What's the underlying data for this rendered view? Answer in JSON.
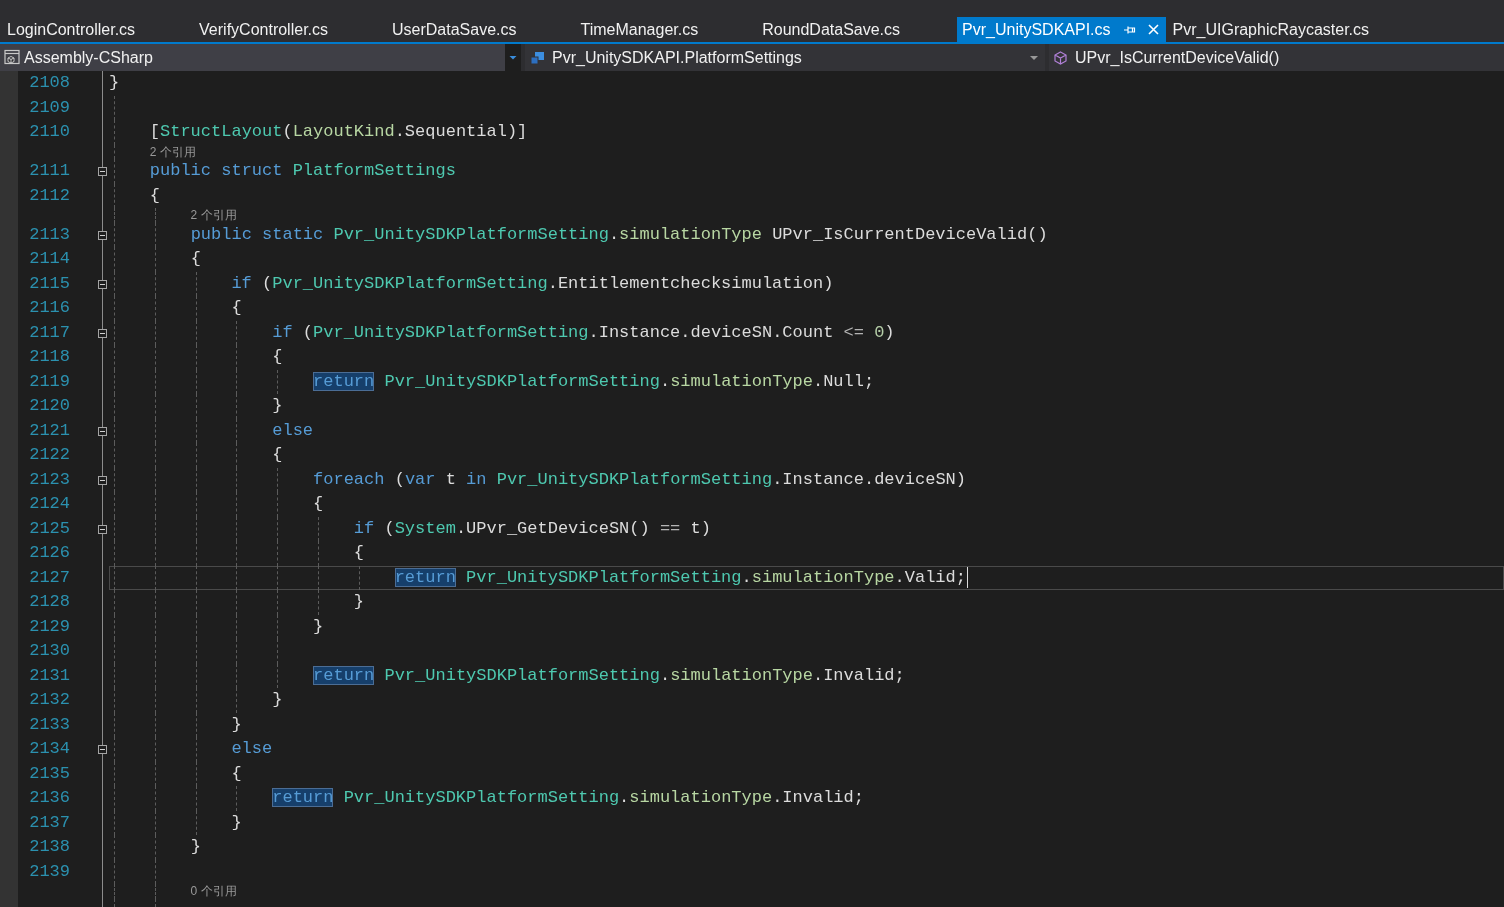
{
  "tabs": [
    {
      "label": "LoginController.cs",
      "selected": false
    },
    {
      "label": "VerifyController.cs",
      "selected": false
    },
    {
      "label": "UserDataSave.cs",
      "selected": false
    },
    {
      "label": "TimeManager.cs",
      "selected": false
    },
    {
      "label": "RoundDataSave.cs",
      "selected": false
    },
    {
      "label": "Pvr_UnitySDKAPI.cs",
      "selected": true
    },
    {
      "label": "Pvr_UIGraphicRaycaster.cs",
      "selected": false
    }
  ],
  "navigation_bar": [
    {
      "kind": "project",
      "text": "Assembly-CSharp",
      "focused": true
    },
    {
      "kind": "type",
      "text": "Pvr_UnitySDKAPI.PlatformSettings",
      "focused": false
    },
    {
      "kind": "member",
      "text": "UPvr_IsCurrentDeviceValid()",
      "focused": false
    }
  ],
  "editor": {
    "lines": [
      {
        "kind": "code",
        "number": "2108",
        "current": false,
        "tokens": [
          {
            "kind": "plain",
            "text": "}",
            "highlighted": false
          }
        ]
      },
      {
        "kind": "code",
        "number": "2109",
        "current": false
      },
      {
        "kind": "code",
        "number": "2110",
        "current": false,
        "tokens": [
          {
            "kind": "plain",
            "text": "    [",
            "highlighted": false
          },
          {
            "kind": "type",
            "text": "StructLayout",
            "highlighted": false
          },
          {
            "kind": "plain",
            "text": "(",
            "highlighted": false
          },
          {
            "kind": "enum",
            "text": "LayoutKind",
            "highlighted": false
          },
          {
            "kind": "plain",
            "text": ".Sequential)]",
            "highlighted": false
          }
        ]
      },
      {
        "kind": "codelens",
        "text": "2 个引用"
      },
      {
        "kind": "code",
        "number": "2111",
        "current": false,
        "expanded": true,
        "tokens": [
          {
            "kind": "keyword",
            "text": "    public struct ",
            "highlighted": false
          },
          {
            "kind": "type",
            "text": "PlatformSettings",
            "highlighted": false
          }
        ]
      },
      {
        "kind": "code",
        "number": "2112",
        "current": false,
        "tokens": [
          {
            "kind": "plain",
            "text": "    {",
            "highlighted": false
          }
        ]
      },
      {
        "kind": "codelens",
        "text": "2 个引用"
      },
      {
        "kind": "code",
        "number": "2113",
        "current": false,
        "expanded": true,
        "tokens": [
          {
            "kind": "keyword",
            "text": "        public static ",
            "highlighted": false
          },
          {
            "kind": "type",
            "text": "Pvr_UnitySDKPlatformSetting",
            "highlighted": false
          },
          {
            "kind": "plain",
            "text": ".",
            "highlighted": false
          },
          {
            "kind": "enum",
            "text": "simulationType",
            "highlighted": false
          },
          {
            "kind": "plain",
            "text": " UPvr_IsCurrentDeviceValid()",
            "highlighted": false
          }
        ]
      },
      {
        "kind": "code",
        "number": "2114",
        "current": false,
        "tokens": [
          {
            "kind": "plain",
            "text": "        {",
            "highlighted": false
          }
        ]
      },
      {
        "kind": "code",
        "number": "2115",
        "current": false,
        "expanded": true,
        "tokens": [
          {
            "kind": "keyword",
            "text": "            if ",
            "highlighted": false
          },
          {
            "kind": "plain",
            "text": "(",
            "highlighted": false
          },
          {
            "kind": "type",
            "text": "Pvr_UnitySDKPlatformSetting",
            "highlighted": false
          },
          {
            "kind": "plain",
            "text": ".Entitlementchecksimulation)",
            "highlighted": false
          }
        ]
      },
      {
        "kind": "code",
        "number": "2116",
        "current": false,
        "tokens": [
          {
            "kind": "plain",
            "text": "            {",
            "highlighted": false
          }
        ]
      },
      {
        "kind": "code",
        "number": "2117",
        "current": false,
        "expanded": true,
        "tokens": [
          {
            "kind": "keyword",
            "text": "                if ",
            "highlighted": false
          },
          {
            "kind": "plain",
            "text": "(",
            "highlighted": false
          },
          {
            "kind": "type",
            "text": "Pvr_UnitySDKPlatformSetting",
            "highlighted": false
          },
          {
            "kind": "plain",
            "text": ".Instance.deviceSN.Count ",
            "highlighted": false
          },
          {
            "kind": "operator",
            "text": "<= ",
            "highlighted": false
          },
          {
            "kind": "number",
            "text": "0",
            "highlighted": false
          },
          {
            "kind": "plain",
            "text": ")",
            "highlighted": false
          }
        ]
      },
      {
        "kind": "code",
        "number": "2118",
        "current": false,
        "tokens": [
          {
            "kind": "plain",
            "text": "                {",
            "highlighted": false
          }
        ]
      },
      {
        "kind": "code",
        "number": "2119",
        "current": false,
        "tokens": [
          {
            "kind": "keyword",
            "text": "                    return",
            "highlighted": true
          },
          {
            "kind": "type",
            "text": " Pvr_UnitySDKPlatformSetting",
            "highlighted": false
          },
          {
            "kind": "plain",
            "text": ".",
            "highlighted": false
          },
          {
            "kind": "enum",
            "text": "simulationType",
            "highlighted": false
          },
          {
            "kind": "plain",
            "text": ".Null;",
            "highlighted": false
          }
        ]
      },
      {
        "kind": "code",
        "number": "2120",
        "current": false,
        "tokens": [
          {
            "kind": "plain",
            "text": "                }",
            "highlighted": false
          }
        ]
      },
      {
        "kind": "code",
        "number": "2121",
        "current": false,
        "expanded": true,
        "tokens": [
          {
            "kind": "keyword",
            "text": "                else",
            "highlighted": false
          }
        ]
      },
      {
        "kind": "code",
        "number": "2122",
        "current": false,
        "tokens": [
          {
            "kind": "plain",
            "text": "                {",
            "highlighted": false
          }
        ]
      },
      {
        "kind": "code",
        "number": "2123",
        "current": false,
        "expanded": true,
        "tokens": [
          {
            "kind": "keyword",
            "text": "                    foreach ",
            "highlighted": false
          },
          {
            "kind": "plain",
            "text": "(",
            "highlighted": false
          },
          {
            "kind": "keyword",
            "text": "var",
            "highlighted": false
          },
          {
            "kind": "plain",
            "text": " t ",
            "highlighted": false
          },
          {
            "kind": "keyword",
            "text": "in",
            "highlighted": false
          },
          {
            "kind": "type",
            "text": " Pvr_UnitySDKPlatformSetting",
            "highlighted": false
          },
          {
            "kind": "plain",
            "text": ".Instance.deviceSN)",
            "highlighted": false
          }
        ]
      },
      {
        "kind": "code",
        "number": "2124",
        "current": false,
        "tokens": [
          {
            "kind": "plain",
            "text": "                    {",
            "highlighted": false
          }
        ]
      },
      {
        "kind": "code",
        "number": "2125",
        "current": false,
        "expanded": true,
        "tokens": [
          {
            "kind": "keyword",
            "text": "                        if ",
            "highlighted": false
          },
          {
            "kind": "plain",
            "text": "(",
            "highlighted": false
          },
          {
            "kind": "type",
            "text": "System",
            "highlighted": false
          },
          {
            "kind": "plain",
            "text": ".UPvr_GetDeviceSN() ",
            "highlighted": false
          },
          {
            "kind": "operator",
            "text": "==",
            "highlighted": false
          },
          {
            "kind": "plain",
            "text": " t)",
            "highlighted": false
          }
        ]
      },
      {
        "kind": "code",
        "number": "2126",
        "current": false,
        "tokens": [
          {
            "kind": "plain",
            "text": "                        {",
            "highlighted": false
          }
        ]
      },
      {
        "kind": "code",
        "number": "2127",
        "current": true,
        "tokens": [
          {
            "kind": "keyword",
            "text": "                            return",
            "highlighted": true
          },
          {
            "kind": "type",
            "text": " Pvr_UnitySDKPlatformSetting",
            "highlighted": false
          },
          {
            "kind": "plain",
            "text": ".",
            "highlighted": false
          },
          {
            "kind": "enum",
            "text": "simulationType",
            "highlighted": false
          },
          {
            "kind": "plain",
            "text": ".Valid;",
            "highlighted": false
          }
        ]
      },
      {
        "kind": "code",
        "number": "2128",
        "current": false,
        "tokens": [
          {
            "kind": "plain",
            "text": "                        }",
            "highlighted": false
          }
        ]
      },
      {
        "kind": "code",
        "number": "2129",
        "current": false,
        "tokens": [
          {
            "kind": "plain",
            "text": "                    }",
            "highlighted": false
          }
        ]
      },
      {
        "kind": "code",
        "number": "2130",
        "current": false
      },
      {
        "kind": "code",
        "number": "2131",
        "current": false,
        "tokens": [
          {
            "kind": "keyword",
            "text": "                    return",
            "highlighted": true
          },
          {
            "kind": "type",
            "text": " Pvr_UnitySDKPlatformSetting",
            "highlighted": false
          },
          {
            "kind": "plain",
            "text": ".",
            "highlighted": false
          },
          {
            "kind": "enum",
            "text": "simulationType",
            "highlighted": false
          },
          {
            "kind": "plain",
            "text": ".Invalid;",
            "highlighted": false
          }
        ]
      },
      {
        "kind": "code",
        "number": "2132",
        "current": false,
        "tokens": [
          {
            "kind": "plain",
            "text": "                }",
            "highlighted": false
          }
        ]
      },
      {
        "kind": "code",
        "number": "2133",
        "current": false,
        "tokens": [
          {
            "kind": "plain",
            "text": "            }",
            "highlighted": false
          }
        ]
      },
      {
        "kind": "code",
        "number": "2134",
        "current": false,
        "expanded": true,
        "tokens": [
          {
            "kind": "keyword",
            "text": "            else",
            "highlighted": false
          }
        ]
      },
      {
        "kind": "code",
        "number": "2135",
        "current": false,
        "tokens": [
          {
            "kind": "plain",
            "text": "            {",
            "highlighted": false
          }
        ]
      },
      {
        "kind": "code",
        "number": "2136",
        "current": false,
        "tokens": [
          {
            "kind": "keyword",
            "text": "                return",
            "highlighted": true
          },
          {
            "kind": "type",
            "text": " Pvr_UnitySDKPlatformSetting",
            "highlighted": false
          },
          {
            "kind": "plain",
            "text": ".",
            "highlighted": false
          },
          {
            "kind": "enum",
            "text": "simulationType",
            "highlighted": false
          },
          {
            "kind": "plain",
            "text": ".Invalid;",
            "highlighted": false
          }
        ]
      },
      {
        "kind": "code",
        "number": "2137",
        "current": false,
        "tokens": [
          {
            "kind": "plain",
            "text": "            }",
            "highlighted": false
          }
        ]
      },
      {
        "kind": "code",
        "number": "2138",
        "current": false,
        "tokens": [
          {
            "kind": "plain",
            "text": "        }",
            "highlighted": false
          }
        ]
      },
      {
        "kind": "code",
        "number": "2139",
        "current": false
      },
      {
        "kind": "codelens",
        "text": "0 个引用"
      }
    ]
  }
}
